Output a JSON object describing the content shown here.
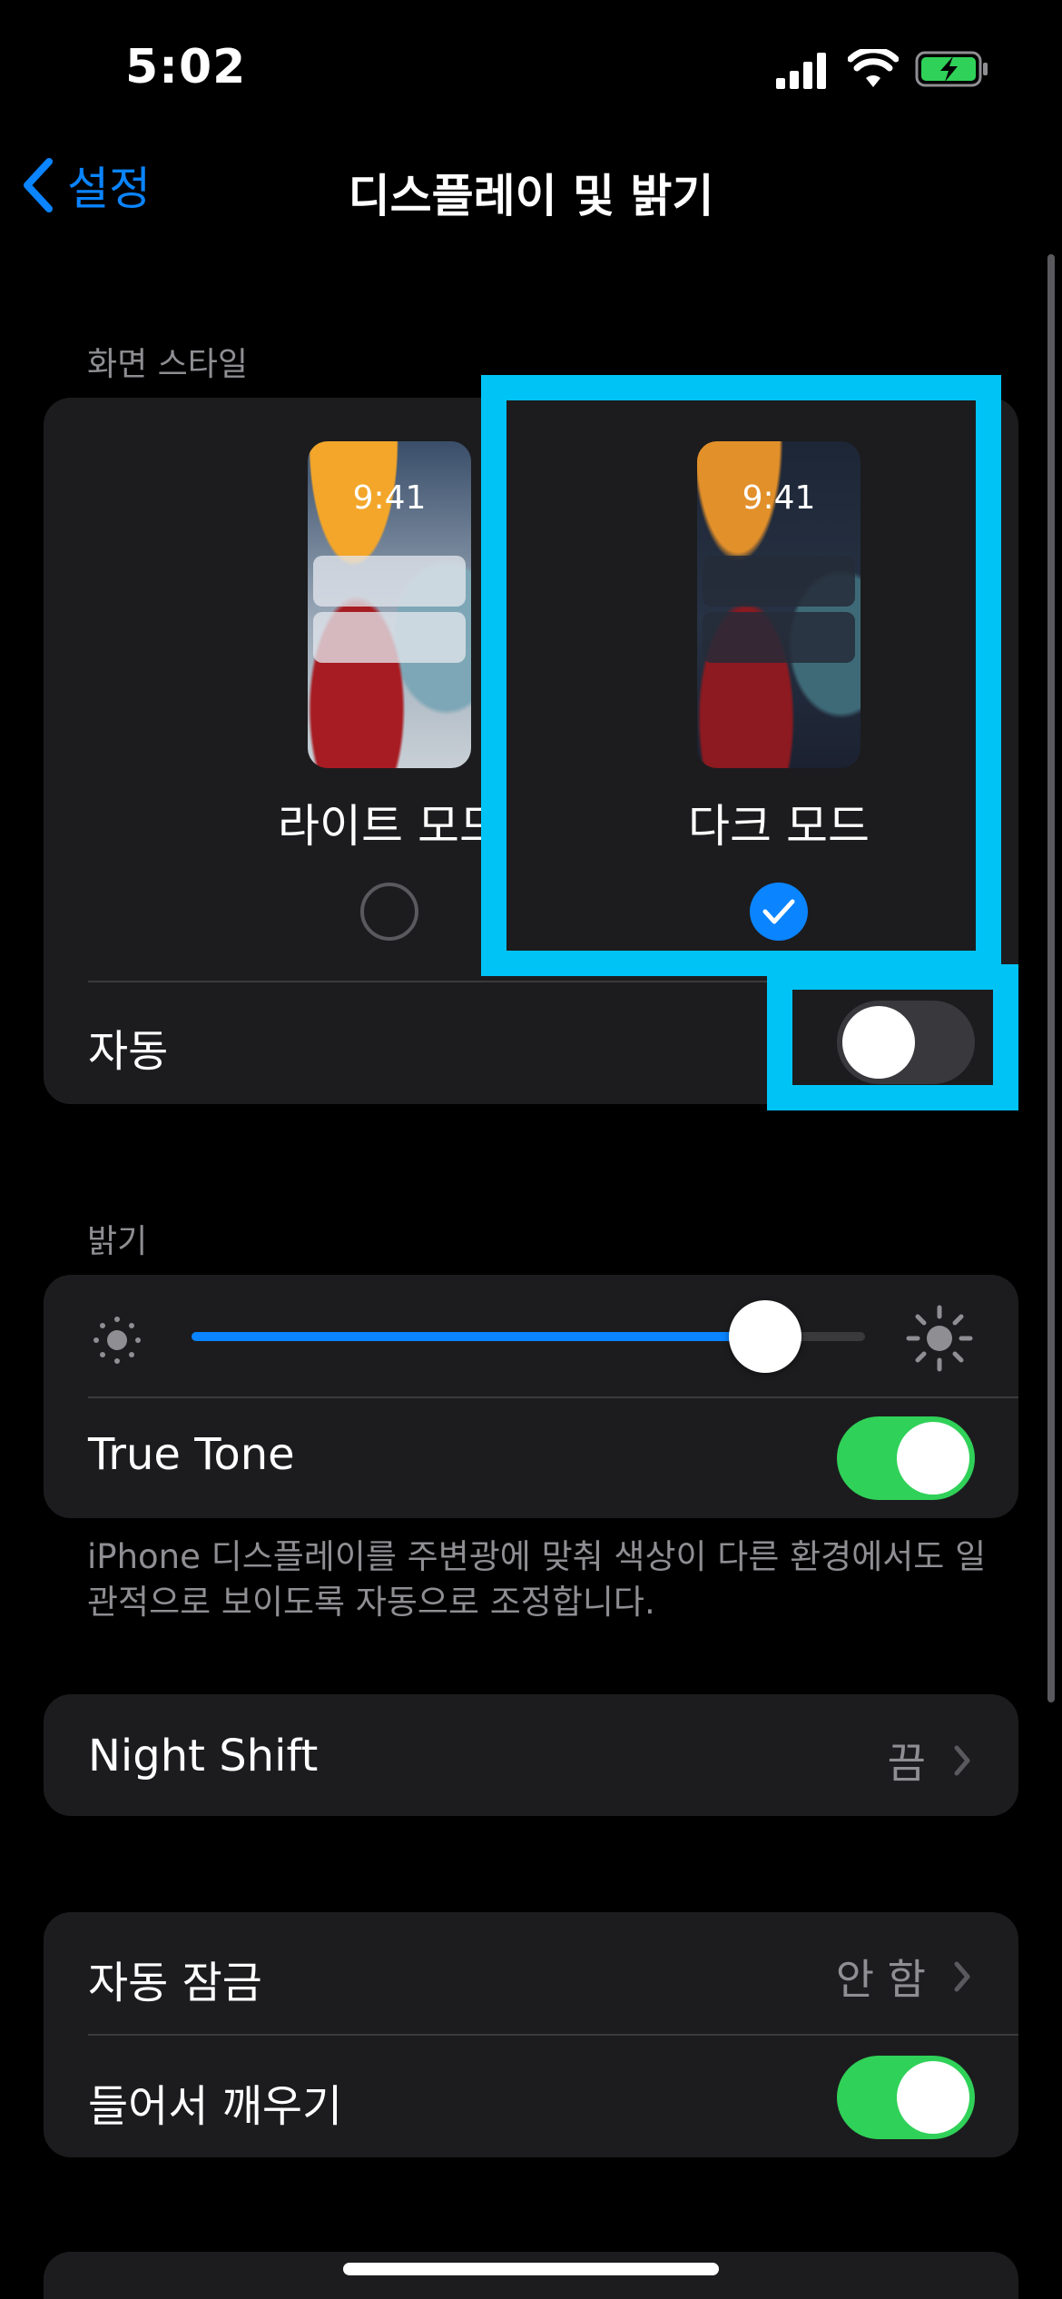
{
  "status_bar": {
    "time": "5:02"
  },
  "nav": {
    "back_label": "설정",
    "title": "디스플레이 및 밝기"
  },
  "appearance": {
    "section_header": "화면 스타일",
    "preview_clock": "9:41",
    "light_label": "라이트 모드",
    "dark_label": "다크 모드",
    "selected": "dark",
    "auto_label": "자동",
    "auto_enabled": false
  },
  "brightness": {
    "section_header": "밝기",
    "level_percent": 85,
    "true_tone_label": "True Tone",
    "true_tone_enabled": true,
    "footnote": "iPhone 디스플레이를 주변광에 맞춰 색상이 다른 환경에서도 일관적으로 보이도록 자동으로 조정합니다."
  },
  "night_shift": {
    "label": "Night Shift",
    "value": "끔"
  },
  "lock": {
    "auto_lock_label": "자동 잠금",
    "auto_lock_value": "안 함",
    "raise_to_wake_label": "들어서 깨우기",
    "raise_to_wake_enabled": true
  },
  "colors": {
    "accent": "#0a84ff",
    "toggle_on": "#30d158",
    "highlight": "#00c3f5",
    "card": "#1c1c1e"
  }
}
